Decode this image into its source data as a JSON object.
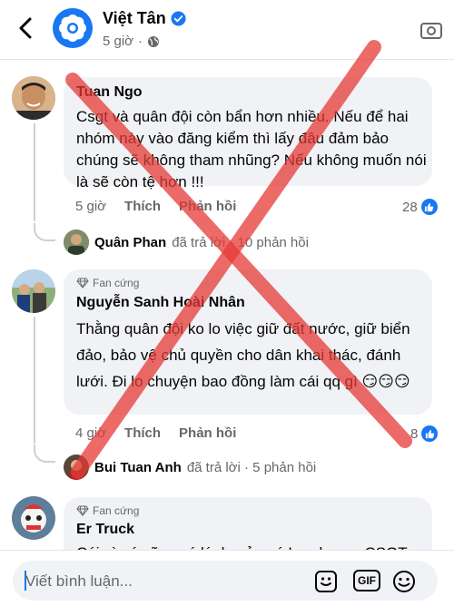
{
  "header": {
    "page_name": "Việt Tân",
    "time": "5 giờ"
  },
  "comments": [
    {
      "author": "Tuan Ngo",
      "text": "Csgt và quân đội còn bẩn hơn nhiều. Nếu để hai nhóm này vào đăng kiểm thì lấy đâu đảm bảo chúng sẽ không tham nhũng? Nếu không muốn nói là sẽ còn tệ hơn !!!",
      "time": "5 giờ",
      "like": "Thích",
      "reply": "Phản hồi",
      "reactions": "28",
      "reply_author": "Quân Phan",
      "reply_info": "đã trả lời · 10 phản hồi"
    },
    {
      "badge": "Fan cứng",
      "author": "Nguyễn Sanh Hoài Nhân",
      "text": "Thằng quân đội ko lo việc giữ đất nước, giữ biển đảo, bảo vệ chủ quyền cho dân khai thác, đánh lưới. Đi lo chuyện bao đồng làm cái qq gì 😏😏😏",
      "time": "4 giờ",
      "like": "Thích",
      "reply": "Phản hồi",
      "reactions": "8",
      "reply_author": "Bui Tuan Anh",
      "reply_info": "đã trả lời · 5 phản hồi"
    },
    {
      "badge": "Fan cứng",
      "author": "Er Truck",
      "text": "Cái gì nó cũng có lý do của nó Lực lượng CSGT"
    }
  ],
  "composer": {
    "placeholder": "Viết bình luận...",
    "gif_label": "GIF"
  },
  "colors": {
    "accent": "#1877f2",
    "overlay_x": "#e53935"
  }
}
